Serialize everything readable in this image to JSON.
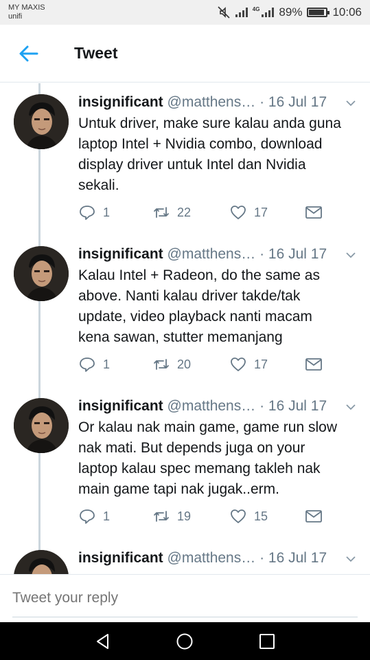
{
  "status_bar": {
    "carrier": "MY MAXIS",
    "network": "unifi",
    "net_type": "4G",
    "battery": "89%",
    "battery_level": 0.89,
    "time": "10:06",
    "icons": [
      "mute-icon",
      "signal-icon",
      "signal-icon",
      "battery-icon"
    ]
  },
  "header": {
    "back_icon": "arrow-left-icon",
    "title": "Tweet",
    "accent": "#1da1f2"
  },
  "tweets": [
    {
      "name": "insignificant",
      "handle": "@matthens…",
      "separator": "·",
      "date": "16 Jul 17",
      "text": "Untuk driver, make sure kalau anda guna\nlaptop Intel + Nvidia combo, download\ndisplay driver untuk Intel dan Nvidia\nsekali.",
      "replies": "1",
      "retweets": "22",
      "likes": "17"
    },
    {
      "name": "insignificant",
      "handle": "@matthens…",
      "separator": "·",
      "date": "16 Jul 17",
      "text": "Kalau Intel + Radeon, do the same as\nabove. Nanti kalau driver takde/tak\nupdate, video playback nanti macam\nkena sawan, stutter memanjang",
      "replies": "1",
      "retweets": "20",
      "likes": "17"
    },
    {
      "name": "insignificant",
      "handle": "@matthens…",
      "separator": "·",
      "date": "16 Jul 17",
      "text": "Or kalau nak main game, game run slow\nnak mati. But depends juga on your\nlaptop kalau spec memang takleh nak\nmain game tapi nak jugak..erm.",
      "replies": "1",
      "retweets": "19",
      "likes": "15"
    },
    {
      "name": "insignificant",
      "handle": "@matthens…",
      "separator": "·",
      "date": "16 Jul 17"
    }
  ],
  "reply": {
    "placeholder": "Tweet your reply"
  },
  "nav": {
    "icons": [
      "nav-back-icon",
      "nav-home-icon",
      "nav-recent-apps-icon"
    ]
  }
}
